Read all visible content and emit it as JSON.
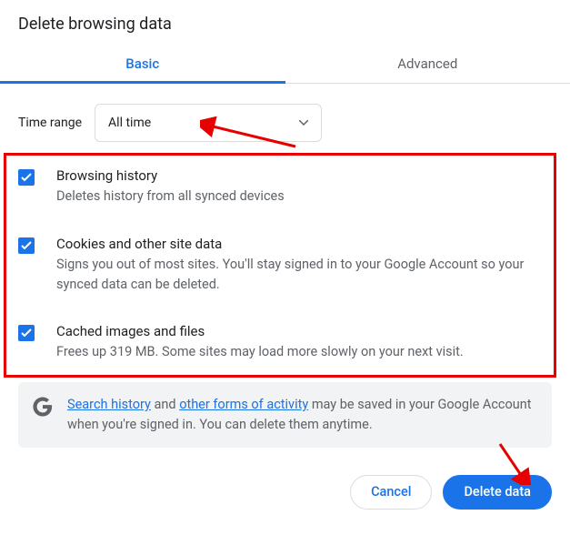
{
  "dialog": {
    "title": "Delete browsing data",
    "tabs": {
      "basic": "Basic",
      "advanced": "Advanced"
    },
    "time": {
      "label": "Time range",
      "value": "All time"
    },
    "options": [
      {
        "checked": true,
        "title": "Browsing history",
        "description": "Deletes history from all synced devices"
      },
      {
        "checked": true,
        "title": "Cookies and other site data",
        "description": "Signs you out of most sites. You'll stay signed in to your Google Account so your synced data can be deleted."
      },
      {
        "checked": true,
        "title": "Cached images and files",
        "description": "Frees up 319 MB. Some sites may load more slowly on your next visit."
      }
    ],
    "info": {
      "link1": "Search history",
      "mid1": " and ",
      "link2": "other forms of activity",
      "tail": " may be saved in your Google Account when you're signed in. You can delete them anytime."
    },
    "buttons": {
      "cancel": "Cancel",
      "delete": "Delete data"
    }
  }
}
